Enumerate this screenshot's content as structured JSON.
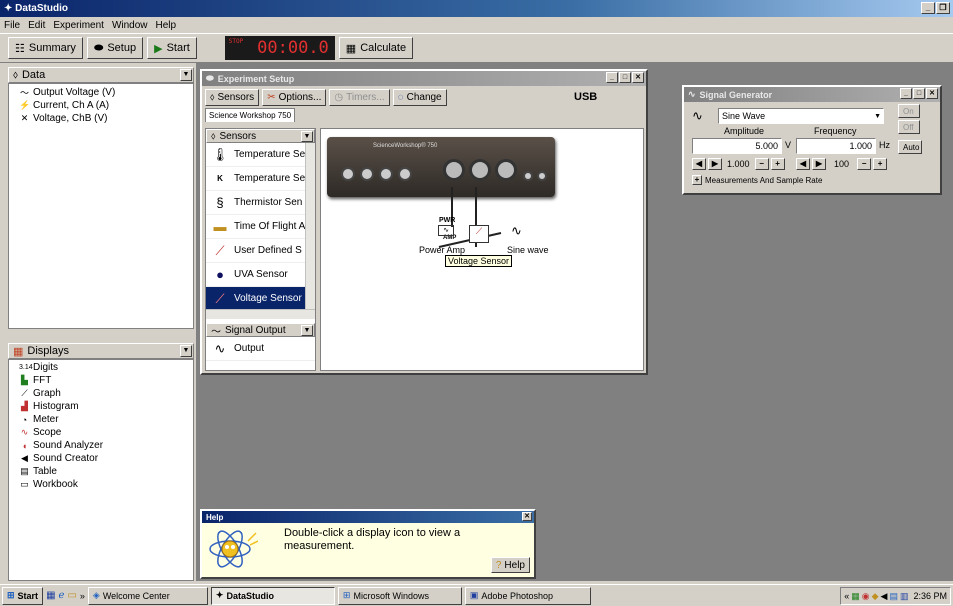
{
  "app": {
    "title": "DataStudio"
  },
  "menu": [
    "File",
    "Edit",
    "Experiment",
    "Window",
    "Help"
  ],
  "toolbar": {
    "summary": "Summary",
    "setup": "Setup",
    "start": "Start",
    "timer": "00:00.0",
    "timer_stop": "STOP",
    "calculate": "Calculate"
  },
  "data_panel": {
    "title": "Data",
    "items": [
      "Output Voltage (V)",
      "Current, Ch A (A)",
      "Voltage, ChB (V)"
    ]
  },
  "displays_panel": {
    "title": "Displays",
    "items": [
      "Digits",
      "FFT",
      "Graph",
      "Histogram",
      "Meter",
      "Scope",
      "Sound Analyzer",
      "Sound Creator",
      "Table",
      "Workbook"
    ]
  },
  "setup_window": {
    "title": "Experiment Setup",
    "sensors_btn": "Sensors",
    "options_btn": "Options...",
    "timers_btn": "Timers...",
    "change_btn": "Change",
    "connection": "USB",
    "tab": "Science Workshop 750",
    "sensor_list_title": "Sensors",
    "sensors": [
      "Temperature Se",
      "Temperature Se",
      "Thermistor Sen",
      "Time Of Flight A",
      "User Defined S",
      "UVA Sensor",
      "Voltage Sensor"
    ],
    "signal_output_title": "Signal Output",
    "signal_output_items": [
      "Output"
    ],
    "diagram": {
      "device_label": "ScienceWorkshop® 750",
      "pwr_label": "PWR",
      "amp_label": "AMP",
      "power_amp_label": "Power Amp",
      "sine_label": "Sine wave",
      "voltage_label": "Voltage Sensor"
    }
  },
  "signal_generator": {
    "title": "Signal Generator",
    "waveform": "Sine Wave",
    "on": "On",
    "off": "Off",
    "auto": "Auto",
    "amplitude_label": "Amplitude",
    "frequency_label": "Frequency",
    "amplitude_value": "5.000",
    "amplitude_unit": "V",
    "frequency_value": "1.000",
    "frequency_unit": "Hz",
    "amp_step": "1.000",
    "freq_step": "100",
    "measurements": "Measurements And Sample Rate"
  },
  "help": {
    "title": "Help",
    "message": "Double-click a display icon to view a measurement.",
    "button": "Help"
  },
  "taskbar": {
    "start": "Start",
    "items": [
      "Welcome Center",
      "DataStudio",
      "Microsoft Windows",
      "Adobe Photoshop"
    ],
    "time": "2:36 PM"
  }
}
